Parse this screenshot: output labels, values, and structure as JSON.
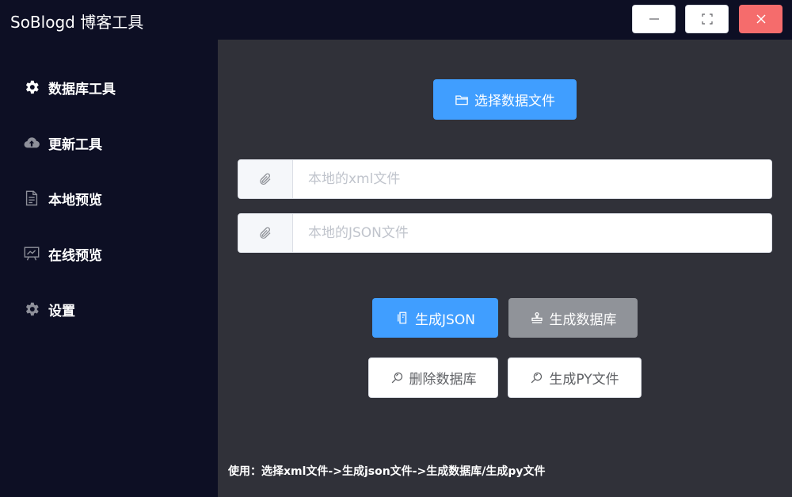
{
  "app": {
    "title": "SoBlogd 博客工具"
  },
  "window_controls": {
    "minimize_icon": "minimize-icon",
    "maximize_icon": "fullscreen-icon",
    "close_icon": "close-icon"
  },
  "sidebar": {
    "items": [
      {
        "label": "数据库工具",
        "icon": "gear-icon"
      },
      {
        "label": "更新工具",
        "icon": "cloud-upload-icon"
      },
      {
        "label": "本地预览",
        "icon": "document-icon"
      },
      {
        "label": "在线预览",
        "icon": "presentation-icon"
      },
      {
        "label": "设置",
        "icon": "gear-icon"
      }
    ]
  },
  "main": {
    "select_file_button": "选择数据文件",
    "xml_input": {
      "placeholder": "本地的xml文件",
      "value": ""
    },
    "json_input": {
      "placeholder": "本地的JSON文件",
      "value": ""
    },
    "generate_json_button": "生成JSON",
    "generate_db_button": "生成数据库",
    "delete_db_button": "删除数据库",
    "generate_py_button": "生成PY文件",
    "usage_text": "使用：选择xml文件->生成json文件->生成数据库/生成py文件"
  },
  "colors": {
    "primary": "#409eff",
    "info": "#909399",
    "danger": "#f56c6c",
    "sidebar_bg": "#0d0f24",
    "main_bg": "#303139"
  }
}
